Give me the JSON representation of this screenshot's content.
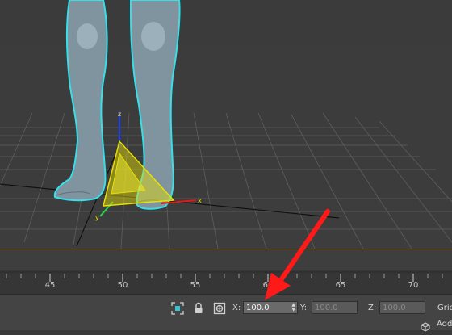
{
  "viewport": {
    "gizmo_axes": {
      "x": "x",
      "y": "y",
      "z": "z"
    }
  },
  "timeline": {
    "ticks": [
      "45",
      "50",
      "55",
      "60",
      "65",
      "70"
    ]
  },
  "status_bar": {
    "coords": {
      "x_label": "X:",
      "x_value": "100.0",
      "y_label": "Y:",
      "y_value": "100.0",
      "z_label": "Z:",
      "z_value": "100.0"
    },
    "grid_label": "Grid",
    "add_label": "Add"
  },
  "colors": {
    "selection_outline": "#36e0ea",
    "gizmo": "#e8e000",
    "annotation_arrow": "#ff1a1a",
    "timeline_line": "#9a7a2a"
  },
  "icons": [
    "selection-lock-icon",
    "lock-icon",
    "absolute-mode-icon",
    "add-time-tag-icon"
  ]
}
